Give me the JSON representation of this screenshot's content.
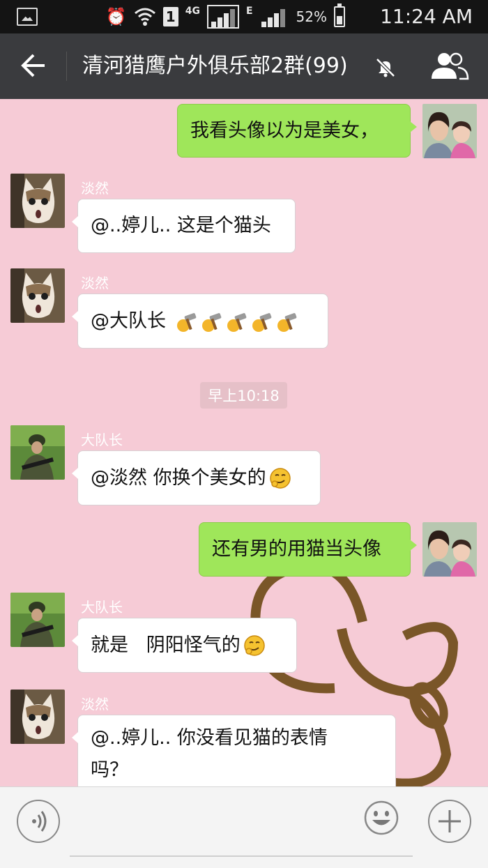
{
  "status_bar": {
    "network_type": "4G",
    "sim_badge": "1",
    "data_type": "E",
    "battery_percent": "52%",
    "time": "11:24 AM"
  },
  "header": {
    "title": "清河猎鹰户外俱乐部2群(99)",
    "back_icon": "arrow-left-icon",
    "mute_icon": "bell-off-icon",
    "members_icon": "group-members-icon"
  },
  "messages": [
    {
      "direction": "out",
      "sender": "",
      "text": "我看头像以为是美女，",
      "avatar": "self-avatar"
    },
    {
      "direction": "in",
      "sender": "淡然",
      "text": "@..婷儿.. 这是个猫头",
      "avatar": "cat-avatar"
    },
    {
      "direction": "in",
      "sender": "淡然",
      "text": "@大队长 ",
      "emoji": "hammer-emoji",
      "emoji_count": 5,
      "avatar": "cat-avatar"
    },
    {
      "direction": "in",
      "sender": "大队长",
      "text": "@淡然 你换个美女的",
      "emoji": "smirk-emoji",
      "avatar": "soldier-avatar"
    },
    {
      "direction": "out",
      "sender": "",
      "text": "还有男的用猫当头像",
      "avatar": "self-avatar"
    },
    {
      "direction": "in",
      "sender": "大队长",
      "text": "就是   阴阳怪气的",
      "emoji": "smirk-emoji",
      "avatar": "soldier-avatar"
    },
    {
      "direction": "in",
      "sender": "淡然",
      "text": "@..婷儿.. 你没看见猫的表情\n吗？",
      "avatar": "cat-avatar"
    }
  ],
  "timestamp_divider": "早上10:18",
  "input_bar": {
    "voice_icon": "voice-icon",
    "emoji_icon": "emoji-icon",
    "plus_icon": "plus-icon",
    "text_value": ""
  },
  "colors": {
    "chat_background": "#f6cbd6",
    "outgoing_bubble": "#9fe65a",
    "incoming_bubble": "#ffffff",
    "title_bar": "#3a3b3e",
    "status_bar": "#141414"
  }
}
